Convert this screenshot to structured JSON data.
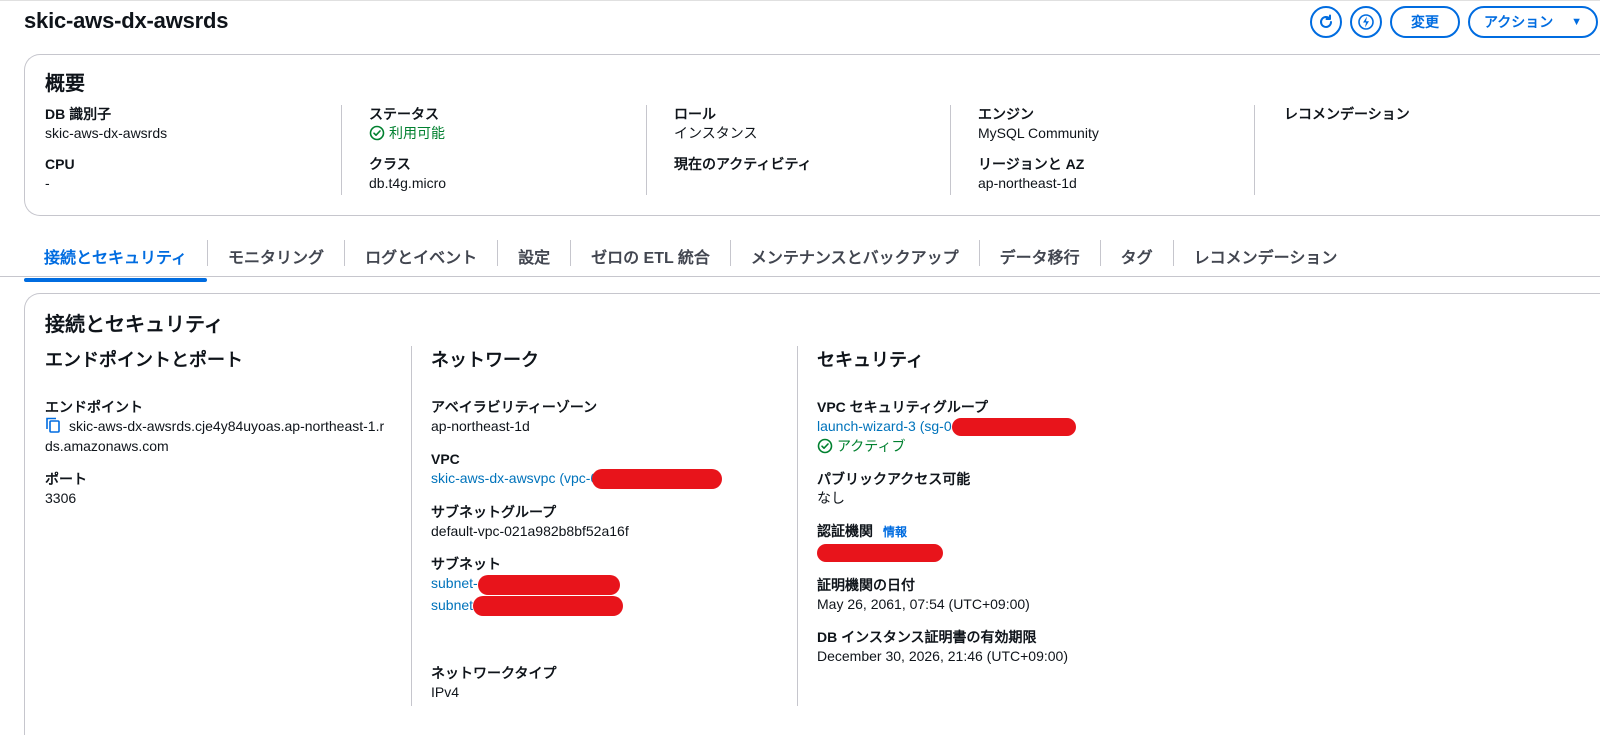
{
  "header": {
    "title": "skic-aws-dx-awsrds",
    "refresh_icon": "refresh-icon",
    "lightning_icon": "lightning-icon",
    "change_label": "変更",
    "actions_label": "アクション",
    "accent": "#006ce0"
  },
  "overview": {
    "title": "概要",
    "db_id_label": "DB 識別子",
    "db_id_value": "skic-aws-dx-awsrds",
    "cpu_label": "CPU",
    "cpu_value": "-",
    "status_label": "ステータス",
    "status_value": "利用可能",
    "class_label": "クラス",
    "class_value": "db.t4g.micro",
    "role_label": "ロール",
    "role_value": "インスタンス",
    "activity_label": "現在のアクティビティ",
    "engine_label": "エンジン",
    "engine_value": "MySQL Community",
    "region_label": "リージョンと AZ",
    "region_value": "ap-northeast-1d",
    "recommend_label": "レコメンデーション"
  },
  "tabs": [
    {
      "label": "接続とセキュリティ",
      "active": true
    },
    {
      "label": "モニタリング"
    },
    {
      "label": "ログとイベント"
    },
    {
      "label": "設定"
    },
    {
      "label": "ゼロの ETL 統合"
    },
    {
      "label": "メンテナンスとバックアップ"
    },
    {
      "label": "データ移行"
    },
    {
      "label": "タグ"
    },
    {
      "label": "レコメンデーション"
    }
  ],
  "connectivity": {
    "title": "接続とセキュリティ",
    "endpoint_section": {
      "title": "エンドポイントとポート",
      "endpoint_label": "エンドポイント",
      "endpoint_line1": "skic-aws-dx-awsrds.cje4y84uyoas.ap-northeast-1.r",
      "endpoint_line2": "ds.amazonaws.com",
      "port_label": "ポート",
      "port_value": "3306"
    },
    "network_section": {
      "title": "ネットワーク",
      "az_label": "アベイラビリティーゾーン",
      "az_value": "ap-northeast-1d",
      "vpc_label": "VPC",
      "vpc_value": "skic-aws-dx-awsvpc (vpc-0",
      "subnet_group_label": "サブネットグループ",
      "subnet_group_value": "default-vpc-021a982b8bf52a16f",
      "subnet_label": "サブネット",
      "subnet_1": "subnet-",
      "subnet_2": "subnet",
      "network_type_label": "ネットワークタイプ",
      "network_type_value": "IPv4"
    },
    "security_section": {
      "title": "セキュリティ",
      "sg_label": "VPC セキュリティグループ",
      "sg_value": "launch-wizard-3 (sg-0",
      "sg_status": "アクティブ",
      "public_label": "パブリックアクセス可能",
      "public_value": "なし",
      "ca_label": "認証機関",
      "ca_info": "情報",
      "ca_date_label": "証明機関の日付",
      "ca_date_value": "May 26, 2061, 07:54 (UTC+09:00)",
      "cert_expiry_label": "DB インスタンス証明書の有効期限",
      "cert_expiry_value": "December 30, 2026, 21:46 (UTC+09:00)"
    }
  },
  "colors": {
    "link": "#0073bb",
    "success": "#00802f",
    "redaction": "#e8141b"
  }
}
